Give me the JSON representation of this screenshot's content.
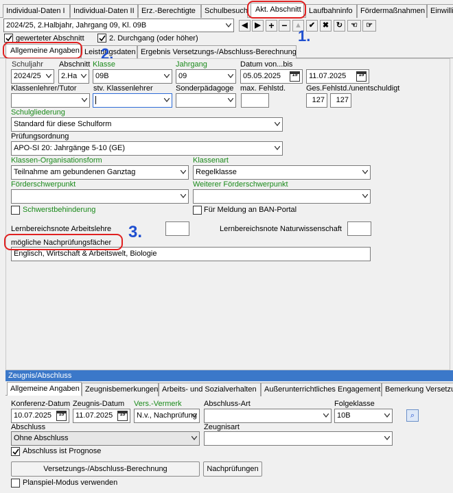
{
  "top_tabs": [
    "Individual-Daten I",
    "Individual-Daten II",
    "Erz.-Berechtigte",
    "Schulbesuch",
    "Akt. Abschnitt",
    "Laufbahninfo",
    "Fördermaßnahmen",
    "Einwilligungen"
  ],
  "section_select": "2024/25, 2.Halbjahr, Jahrgang 09, Kl. 09B",
  "gewerteter_label": "gewerteter Abschnitt",
  "durchgang_label": "2. Durchgang (oder höher)",
  "inner_tabs": [
    "Allgemeine Angaben",
    "Leistungsdaten",
    "Ergebnis Versetzungs-/Abschluss-Berechnung"
  ],
  "annotations": {
    "one": "1.",
    "two": "2.",
    "three": "3."
  },
  "labels": {
    "schuljahr": "Schuljahr",
    "abschnitt": "Abschnitt",
    "klasse": "Klasse",
    "jahrgang": "Jahrgang",
    "datum": "Datum von...bis",
    "klassenlehrer": "Klassenlehrer/Tutor",
    "stv": "stv. Klassenlehrer",
    "sonder": "Sonderpädagoge",
    "maxfehl": "max. Fehlstd.",
    "gesfehl": "Ges.Fehlstd./unentschuldigt",
    "schulgliederung": "Schulgliederung",
    "pruefungsordnung": "Prüfungsordnung",
    "klassenorg": "Klassen-Organisationsform",
    "klassenart": "Klassenart",
    "foerder": "Förderschwerpunkt",
    "weiterfoerder": "Weiterer Förderschwerpunkt",
    "schwerst": "Schwerstbehinderung",
    "ban": "Für Meldung an BAN-Portal",
    "lb_arbeitslehre": "Lernbereichsnote Arbeitslehre",
    "lb_natur": "Lernbereichsnote Naturwissenschaft",
    "nachpruef": "mögliche Nachprüfungsfächer"
  },
  "values": {
    "schuljahr": "2024/25",
    "abschnitt": "2.Ha",
    "klasse": "09B",
    "jahrgang": "09",
    "datum_von": "05.05.2025",
    "datum_bis": "11.07.2025",
    "fehl_ges": "127",
    "fehl_unent": "127",
    "schulgliederung": "Standard für diese Schulform",
    "pruefungsordnung": "APO-SI 20: Jahrgänge 5-10 (GE)",
    "klassenorg": "Teilnahme am gebundenen Ganztag",
    "klassenart": "Regelklasse",
    "nachpruef": "Englisch, Wirtschaft & Arbeitswelt, Biologie"
  },
  "zeugnis": {
    "header": "Zeugnis/Abschluss",
    "tabs": [
      "Allgemeine Angaben",
      "Zeugnisbemerkungen",
      "Arbeits- und Sozialverhalten",
      "Außerunterrichtliches Engagement",
      "Bemerkung Versetzung"
    ],
    "labels": {
      "konferenz": "Konferenz-Datum",
      "zeugnis": "Zeugnis-Datum",
      "vers": "Vers.-Vermerk",
      "abschlussart": "Abschluss-Art",
      "folgeklasse": "Folgeklasse",
      "abschluss": "Abschluss",
      "zeugnisart": "Zeugnisart",
      "prognose": "Abschluss ist Prognose",
      "planspiel": "Planspiel-Modus verwenden"
    },
    "values": {
      "konferenz": "10.07.2025",
      "zeugnis": "11.07.2025",
      "vers": "N.v., Nachprüfung",
      "folgeklasse": "10B",
      "abschluss": "Ohne Abschluss"
    },
    "buttons": {
      "berechnung": "Versetzungs-/Abschluss-Berechnung",
      "nachpruefungen": "Nachprüfungen"
    }
  }
}
